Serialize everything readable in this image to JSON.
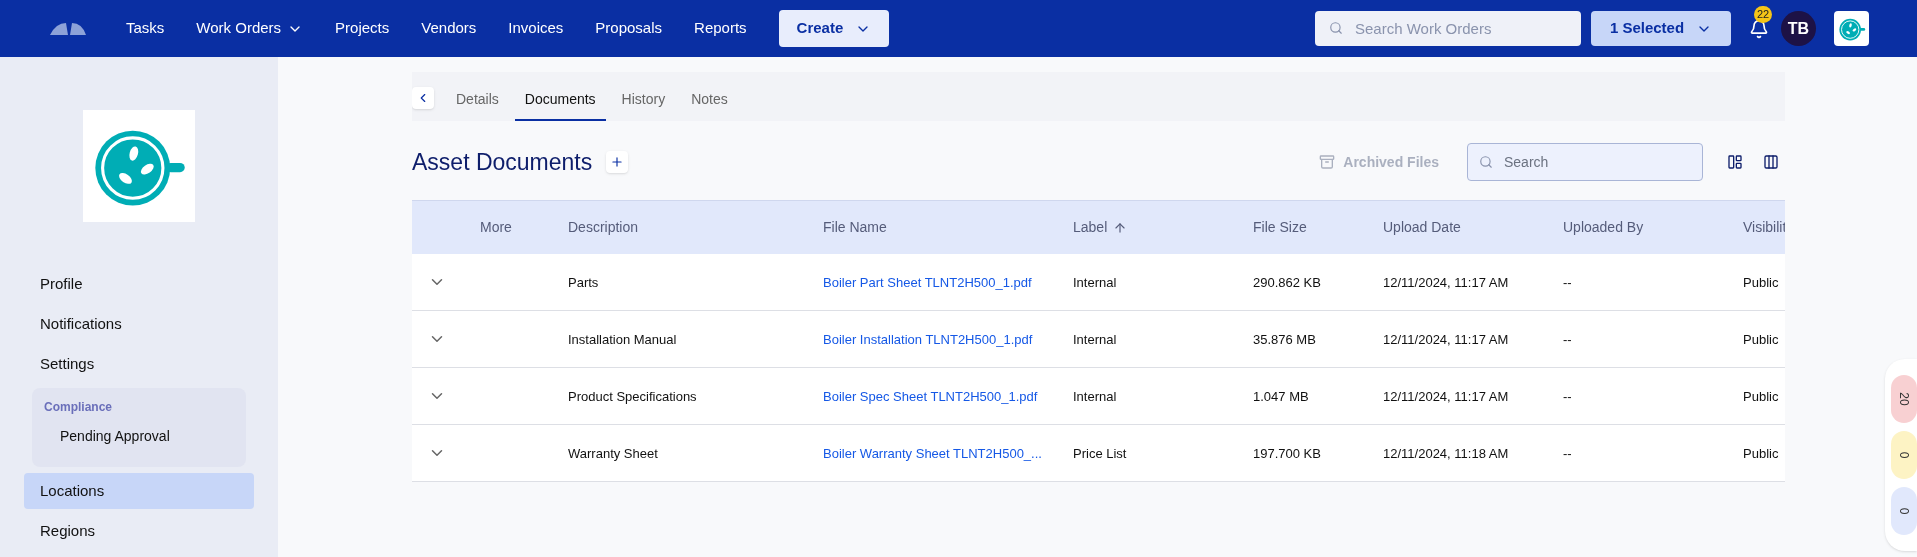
{
  "nav": {
    "items": [
      {
        "label": "Tasks",
        "dropdown": false
      },
      {
        "label": "Work Orders",
        "dropdown": true
      },
      {
        "label": "Projects",
        "dropdown": false
      },
      {
        "label": "Vendors",
        "dropdown": false
      },
      {
        "label": "Invoices",
        "dropdown": false
      },
      {
        "label": "Proposals",
        "dropdown": false
      },
      {
        "label": "Reports",
        "dropdown": false
      }
    ],
    "create_button": "Create",
    "search": {
      "placeholder": "Search Work Orders"
    },
    "selection_button": "1 Selected",
    "notification_count": "22",
    "avatar": "TB"
  },
  "sidebar": {
    "items": [
      {
        "label": "Profile",
        "selected": false
      },
      {
        "label": "Notifications",
        "selected": false
      },
      {
        "label": "Settings",
        "selected": false
      }
    ],
    "group": {
      "title": "Compliance",
      "items": [
        "Pending Approval"
      ]
    },
    "items_after": [
      {
        "label": "Locations",
        "selected": true
      },
      {
        "label": "Regions",
        "selected": false
      }
    ]
  },
  "tabs": [
    {
      "label": "Details",
      "selected": false
    },
    {
      "label": "Documents",
      "selected": true
    },
    {
      "label": "History",
      "selected": false
    },
    {
      "label": "Notes",
      "selected": false
    }
  ],
  "section": {
    "title": "Asset Documents",
    "archived_button": "Archived Files",
    "search": {
      "placeholder": "Search"
    }
  },
  "table": {
    "columns": [
      {
        "label": "More",
        "sorted": false
      },
      {
        "label": "Description",
        "sorted": false
      },
      {
        "label": "File Name",
        "sorted": false
      },
      {
        "label": "Label",
        "sorted": true
      },
      {
        "label": "File Size",
        "sorted": false
      },
      {
        "label": "Upload Date",
        "sorted": false
      },
      {
        "label": "Uploaded By",
        "sorted": false
      },
      {
        "label": "Visibilit",
        "sorted": false
      }
    ],
    "rows": [
      {
        "description": "Parts",
        "file_name": "Boiler Part Sheet TLNT2H500_1.pdf",
        "label": "Internal",
        "file_size": "290.862 KB",
        "upload_date": "12/11/2024, 11:17 AM",
        "uploaded_by": "--",
        "visibility": "Public"
      },
      {
        "description": "Installation Manual",
        "file_name": "Boiler Installation TLNT2H500_1.pdf",
        "label": "Internal",
        "file_size": "35.876 MB",
        "upload_date": "12/11/2024, 11:17 AM",
        "uploaded_by": "--",
        "visibility": "Public"
      },
      {
        "description": "Product Specifications",
        "file_name": "Boiler Spec Sheet TLNT2H500_1.pdf",
        "label": "Internal",
        "file_size": "1.047 MB",
        "upload_date": "12/11/2024, 11:17 AM",
        "uploaded_by": "--",
        "visibility": "Public"
      },
      {
        "description": "Warranty Sheet",
        "file_name": "Boiler Warranty Sheet TLNT2H500_...",
        "label": "Price List",
        "file_size": "197.700 KB",
        "upload_date": "12/11/2024, 11:18 AM",
        "uploaded_by": "--",
        "visibility": "Public"
      }
    ]
  },
  "status_counters": [
    {
      "count": "20",
      "color": "#f8d0d2"
    },
    {
      "count": "0",
      "color": "#fdf3c4"
    },
    {
      "count": "0",
      "color": "#e1e8fc"
    }
  ]
}
